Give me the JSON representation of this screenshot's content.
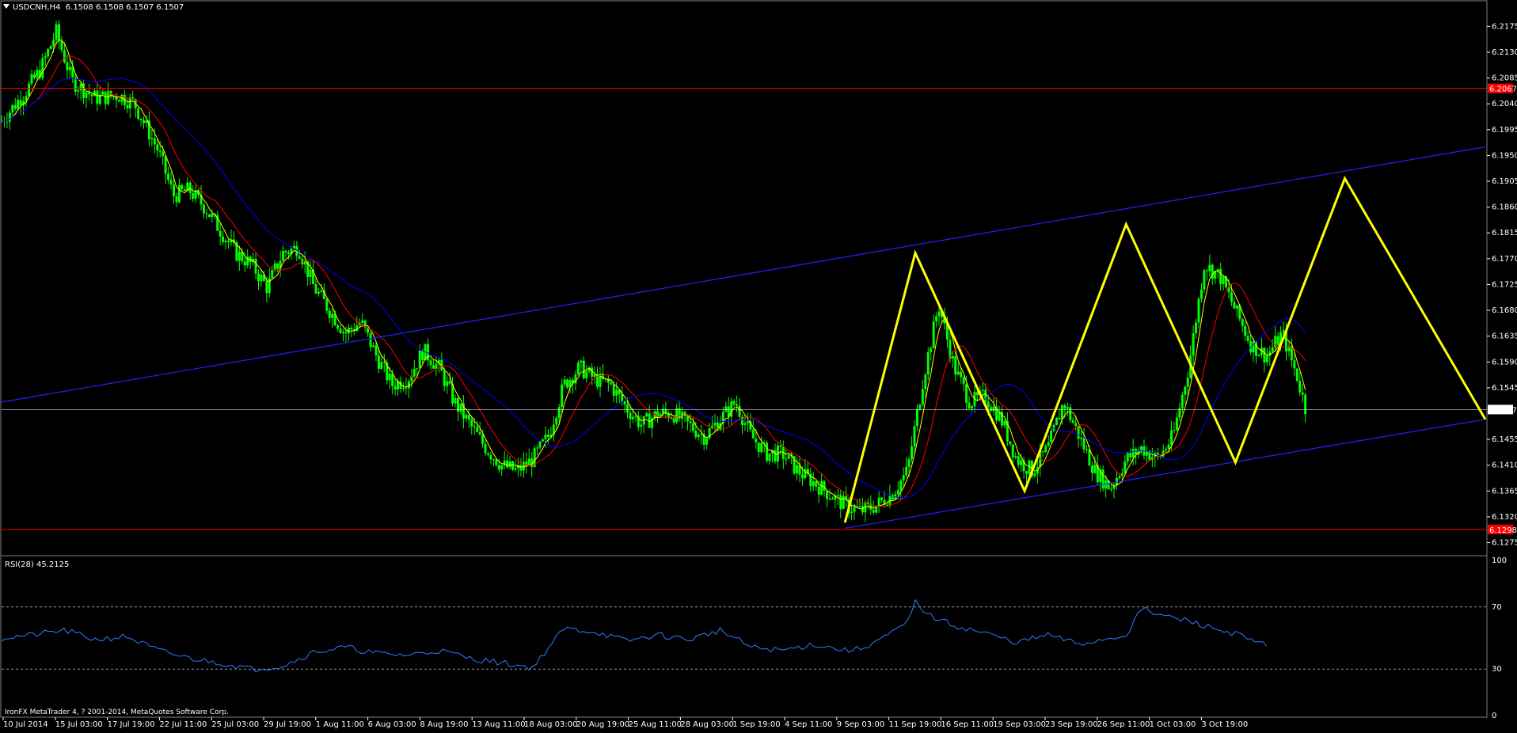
{
  "header": {
    "symbol": "USDCNH,H4",
    "ohlc": "6.1508 6.1508 6.1507 6.1507"
  },
  "rsi_panel": {
    "label": "RSI(28) 45.2125"
  },
  "footer": {
    "copyright": "IronFX MetaTrader 4, ? 2001-2014, MetaQuotes Software Corp."
  },
  "colors": {
    "background": "#000000",
    "candles": "#00ff00",
    "ma_fast": "#ffff00",
    "ma_mid": "#ff0000",
    "ma_slow": "#0000ff",
    "channel": "#2222ff",
    "horizontal_level": "#ff0000",
    "pattern": "#ffff00",
    "rsi_line": "#2a7fff",
    "price_label_bg": "#ff0000"
  },
  "chart_data": [
    {
      "type": "line",
      "panel": "price",
      "symbol": "USDCNH",
      "timeframe": "H4",
      "y_ticks": [
        "6.2175",
        "6.2130",
        "6.2085",
        "6.2040",
        "6.1995",
        "6.1950",
        "6.1905",
        "6.1860",
        "6.1815",
        "6.1770",
        "6.1725",
        "6.1680",
        "6.1635",
        "6.1590",
        "6.1545",
        "6.1455",
        "6.1410",
        "6.1365",
        "6.1320",
        "6.1275"
      ],
      "ylim": [
        6.1255,
        6.221
      ],
      "x_ticks": [
        "10 Jul 2014",
        "15 Jul 03:00",
        "17 Jul 19:00",
        "22 Jul 11:00",
        "25 Jul 03:00",
        "29 Jul 19:00",
        "1 Aug 11:00",
        "6 Aug 03:00",
        "8 Aug 19:00",
        "13 Aug 11:00",
        "18 Aug 03:00",
        "20 Aug 19:00",
        "25 Aug 11:00",
        "28 Aug 03:00",
        "1 Sep 19:00",
        "4 Sep 11:00",
        "9 Sep 03:00",
        "11 Sep 19:00",
        "16 Sep 11:00",
        "19 Sep 03:00",
        "23 Sep 19:00",
        "26 Sep 11:00",
        "1 Oct 03:00",
        "3 Oct 19:00"
      ],
      "horizontal_levels": [
        {
          "value": 6.2067,
          "label": "6.2067",
          "color": "#ff0000"
        },
        {
          "value": 6.1298,
          "label": "6.1298",
          "color": "#ff0000"
        },
        {
          "value": 6.1507,
          "label": "6.1507",
          "color": "#ffffff",
          "current_price": true
        }
      ],
      "price_path": [
        [
          0,
          6.201
        ],
        [
          3,
          6.206
        ],
        [
          5,
          6.21
        ],
        [
          7,
          6.2165
        ],
        [
          9,
          6.208
        ],
        [
          12,
          6.205
        ],
        [
          15,
          6.2055
        ],
        [
          17,
          6.204
        ],
        [
          20,
          6.196
        ],
        [
          22,
          6.188
        ],
        [
          24,
          6.189
        ],
        [
          26,
          6.186
        ],
        [
          28,
          6.182
        ],
        [
          30,
          6.178
        ],
        [
          32,
          6.176
        ],
        [
          34,
          6.172
        ],
        [
          36,
          6.178
        ],
        [
          38,
          6.179
        ],
        [
          40,
          6.172
        ],
        [
          42,
          6.168
        ],
        [
          44,
          6.164
        ],
        [
          46,
          6.166
        ],
        [
          48,
          6.16
        ],
        [
          50,
          6.155
        ],
        [
          52,
          6.156
        ],
        [
          54,
          6.161
        ],
        [
          56,
          6.158
        ],
        [
          58,
          6.152
        ],
        [
          60,
          6.148
        ],
        [
          62,
          6.144
        ],
        [
          64,
          6.141
        ],
        [
          66,
          6.14
        ],
        [
          68,
          6.142
        ],
        [
          70,
          6.146
        ],
        [
          72,
          6.155
        ],
        [
          74,
          6.158
        ],
        [
          76,
          6.156
        ],
        [
          78,
          6.155
        ],
        [
          80,
          6.151
        ],
        [
          82,
          6.148
        ],
        [
          84,
          6.15
        ],
        [
          86,
          6.15
        ],
        [
          88,
          6.148
        ],
        [
          90,
          6.146
        ],
        [
          92,
          6.149
        ],
        [
          94,
          6.152
        ],
        [
          96,
          6.146
        ],
        [
          98,
          6.143
        ],
        [
          100,
          6.143
        ],
        [
          102,
          6.14
        ],
        [
          104,
          6.138
        ],
        [
          106,
          6.136
        ],
        [
          108,
          6.134
        ],
        [
          110,
          6.133
        ],
        [
          112,
          6.134
        ],
        [
          114,
          6.136
        ],
        [
          116,
          6.14
        ],
        [
          118,
          6.156
        ],
        [
          120,
          6.169
        ],
        [
          122,
          6.158
        ],
        [
          124,
          6.152
        ],
        [
          126,
          6.153
        ],
        [
          128,
          6.149
        ],
        [
          130,
          6.142
        ],
        [
          132,
          6.14
        ],
        [
          134,
          6.144
        ],
        [
          136,
          6.152
        ],
        [
          138,
          6.146
        ],
        [
          140,
          6.14
        ],
        [
          142,
          6.137
        ],
        [
          144,
          6.142
        ],
        [
          146,
          6.144
        ],
        [
          148,
          6.142
        ],
        [
          150,
          6.146
        ],
        [
          152,
          6.158
        ],
        [
          154,
          6.176
        ],
        [
          156,
          6.174
        ],
        [
          158,
          6.168
        ],
        [
          160,
          6.162
        ],
        [
          162,
          6.16
        ],
        [
          164,
          6.164
        ],
        [
          166,
          6.156
        ],
        [
          167,
          6.1507
        ]
      ],
      "moving_averages": [
        {
          "name": "fast",
          "color": "#ffff00"
        },
        {
          "name": "mid",
          "color": "#ff0000"
        },
        {
          "name": "slow",
          "color": "#0000ff"
        }
      ],
      "trend_channel": {
        "upper": [
          [
            0,
            6.152
          ],
          [
            190,
            6.1965
          ]
        ],
        "lower": [
          [
            108,
            6.13
          ],
          [
            190,
            6.149
          ]
        ]
      },
      "pattern_zigzag": [
        [
          108,
          6.131
        ],
        [
          117,
          6.178
        ],
        [
          131,
          6.1365
        ],
        [
          144,
          6.183
        ],
        [
          158,
          6.1415
        ],
        [
          172,
          6.191
        ],
        [
          190,
          6.149
        ]
      ]
    },
    {
      "type": "line",
      "panel": "rsi",
      "name": "RSI(28)",
      "last_value": 45.2125,
      "y_ticks": [
        "100",
        "70",
        "30",
        "0"
      ],
      "ylim": [
        0,
        100
      ],
      "levels": [
        70,
        30
      ],
      "values": [
        [
          0,
          50
        ],
        [
          4,
          52
        ],
        [
          8,
          55
        ],
        [
          12,
          49
        ],
        [
          16,
          51
        ],
        [
          20,
          42
        ],
        [
          24,
          37
        ],
        [
          28,
          34
        ],
        [
          32,
          30
        ],
        [
          36,
          32
        ],
        [
          40,
          41
        ],
        [
          44,
          44
        ],
        [
          48,
          40
        ],
        [
          52,
          39
        ],
        [
          56,
          42
        ],
        [
          60,
          37
        ],
        [
          64,
          34
        ],
        [
          68,
          31
        ],
        [
          72,
          56
        ],
        [
          76,
          54
        ],
        [
          80,
          48
        ],
        [
          84,
          52
        ],
        [
          88,
          49
        ],
        [
          92,
          55
        ],
        [
          96,
          44
        ],
        [
          100,
          42
        ],
        [
          104,
          46
        ],
        [
          108,
          42
        ],
        [
          110,
          43
        ],
        [
          112,
          48
        ],
        [
          114,
          53
        ],
        [
          116,
          60
        ],
        [
          117,
          73
        ],
        [
          119,
          64
        ],
        [
          122,
          58
        ],
        [
          126,
          53
        ],
        [
          130,
          47
        ],
        [
          134,
          52
        ],
        [
          138,
          46
        ],
        [
          142,
          50
        ],
        [
          144,
          52
        ],
        [
          146,
          69
        ],
        [
          148,
          65
        ],
        [
          152,
          61
        ],
        [
          156,
          55
        ],
        [
          158,
          53
        ],
        [
          160,
          48
        ],
        [
          162,
          45.2
        ]
      ]
    }
  ]
}
